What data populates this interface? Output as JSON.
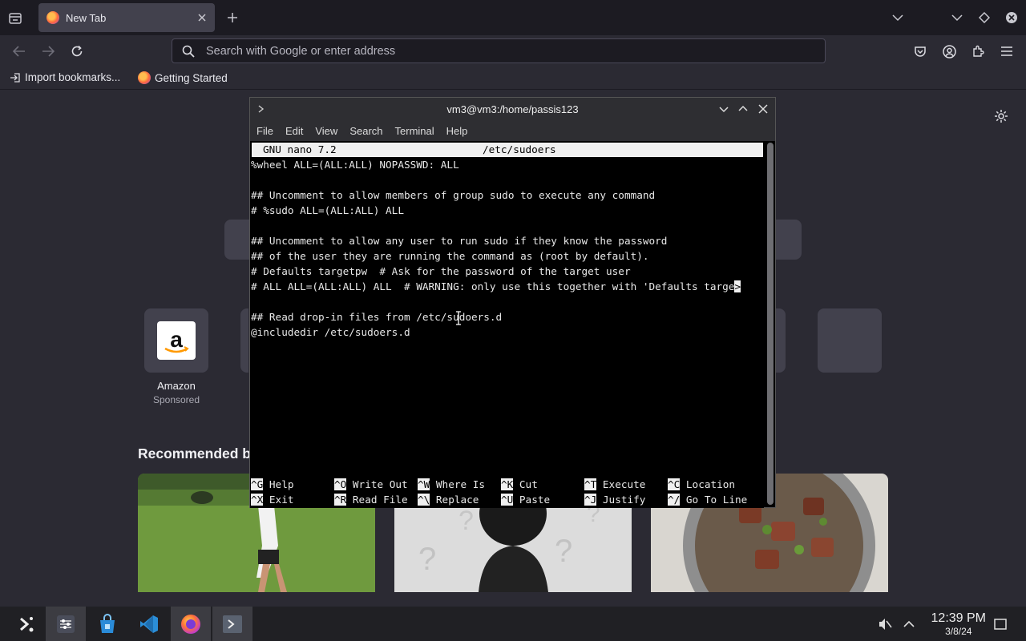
{
  "browser": {
    "tab_title": "New Tab",
    "url_placeholder": "Search with Google or enter address",
    "bookmarks": [
      "Import bookmarks...",
      "Getting Started"
    ]
  },
  "newtab": {
    "shortcut_label": "Amazon",
    "shortcut_sub": "Sponsored",
    "recommended_heading": "Recommended b"
  },
  "terminal": {
    "title": "vm3@vm3:/home/passis123",
    "menu": [
      "File",
      "Edit",
      "View",
      "Search",
      "Terminal",
      "Help"
    ],
    "nano_app": "GNU nano 7.2",
    "nano_file": "/etc/sudoers",
    "lines": [
      "%wheel ALL=(ALL:ALL) NOPASSWD: ALL",
      "",
      "## Uncomment to allow members of group sudo to execute any command",
      "# %sudo ALL=(ALL:ALL) ALL",
      "",
      "## Uncomment to allow any user to run sudo if they know the password",
      "## of the user they are running the command as (root by default).",
      "# Defaults targetpw  # Ask for the password of the target user",
      "# ALL ALL=(ALL:ALL) ALL  # WARNING: only use this together with 'Defaults targe",
      "",
      "## Read drop-in files from /etc/sudoers.d",
      "@includedir /etc/sudoers.d"
    ],
    "overflow_marker": ">",
    "shortcuts_row1": [
      {
        "key": "^G",
        "label": "Help"
      },
      {
        "key": "^O",
        "label": "Write Out"
      },
      {
        "key": "^W",
        "label": "Where Is"
      },
      {
        "key": "^K",
        "label": "Cut"
      },
      {
        "key": "^T",
        "label": "Execute"
      },
      {
        "key": "^C",
        "label": "Location"
      }
    ],
    "shortcuts_row2": [
      {
        "key": "^X",
        "label": "Exit"
      },
      {
        "key": "^R",
        "label": "Read File"
      },
      {
        "key": "^\\",
        "label": "Replace"
      },
      {
        "key": "^U",
        "label": "Paste"
      },
      {
        "key": "^J",
        "label": "Justify"
      },
      {
        "key": "^/",
        "label": "Go To Line"
      }
    ]
  },
  "taskbar": {
    "time": "12:39 PM",
    "date": "3/8/24"
  },
  "colors": {
    "browser_bg": "#2b2a33",
    "tabstrip_bg": "#1c1b22",
    "terminal_bg": "#000000",
    "nano_bar": "#f0f0f0",
    "taskbar_bg": "#202024"
  }
}
